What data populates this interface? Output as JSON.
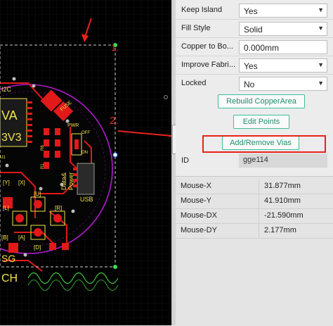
{
  "properties": [
    {
      "label": "Keep Island",
      "value": "Yes",
      "type": "select"
    },
    {
      "label": "Fill Style",
      "value": "Solid",
      "type": "select"
    },
    {
      "label": "Copper to Bo...",
      "value": "0.000mm",
      "type": "input"
    },
    {
      "label": "Improve Fabri...",
      "value": "Yes",
      "type": "select"
    },
    {
      "label": "Locked",
      "value": "No",
      "type": "select"
    }
  ],
  "buttons": {
    "rebuild": "Rebuild CopperArea",
    "edit_points": "Edit Points",
    "add_remove_vias": "Add/Remove Vias"
  },
  "id_field": {
    "label": "ID",
    "value": "gge114"
  },
  "coords": [
    {
      "key": "Mouse-X",
      "value": "31.877mm"
    },
    {
      "key": "Mouse-Y",
      "value": "41.910mm"
    },
    {
      "key": "Mouse-DX",
      "value": "-21.590mm"
    },
    {
      "key": "Mouse-DY",
      "value": "2.177mm"
    }
  ],
  "annotations": {
    "step1": "1.",
    "step2": "2."
  },
  "board_text": {
    "i2c": "I2C",
    "pwr": "PWR",
    "off": "OFF",
    "on": "ON",
    "datapower": "Data&",
    "power": "Power",
    "usb": "USB",
    "u": "[U]",
    "l": "[L]",
    "d": "[D]",
    "r": "[R]",
    "y": "[Y]",
    "b": "[B]",
    "a": "[A]",
    "x": "[X]",
    "sg": "SG",
    "ch": "CH",
    "va": "VA",
    "v3": "3V3",
    "fuse": "FUSE",
    "r6": "R6",
    "r1": "R1",
    "u1": "U1"
  },
  "colors": {
    "canvas_bg": "#000000",
    "grid": "#1a1a1a",
    "board_outline": "#b21ad1",
    "copper": "#e11919",
    "silkscreen": "#f1e34a",
    "selection": "#cfcfcf",
    "annotation": "#e8221b",
    "button_text": "#1f8f70"
  }
}
